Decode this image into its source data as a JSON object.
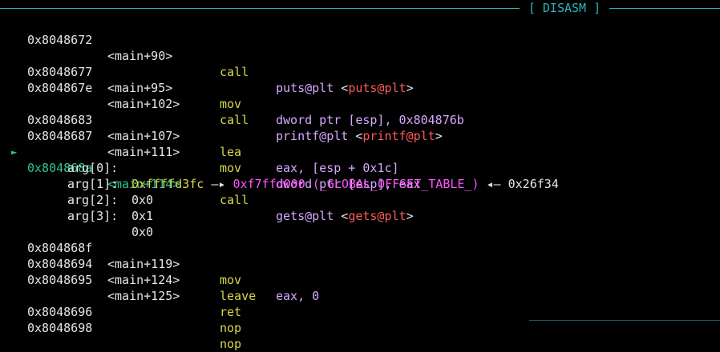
{
  "header": {
    "title": "[ DISASM ]"
  },
  "colors": {
    "accent": "#2bb3c0",
    "current": "#2fc48d",
    "mnemonic": "#d7d74f",
    "symbol": "#d6a8ff",
    "plt_target": "#ff5a5a",
    "pointer": "#ff55ff"
  },
  "lines": {
    "l0": {
      "addr": "0x8048672",
      "sym": "<main+90>",
      "mn": "call",
      "fn": "puts@plt",
      "lt": " <",
      "tgt": "puts@plt",
      "gt": ">"
    },
    "l1": {
      "addr": "0x8048677",
      "sym": "<main+95>",
      "mn": "mov",
      "op1": "dword ptr [esp], ",
      "op2": "0x804876b"
    },
    "l2": {
      "addr": "0x804867e",
      "sym": "<main+102>",
      "mn": "call",
      "fn": "printf@plt",
      "lt": " <",
      "tgt": "printf@plt",
      "gt": ">"
    },
    "l3": {
      "addr": "0x8048683",
      "sym": "<main+107>",
      "mn": "lea",
      "op1": "eax, [esp + ",
      "op2": "0x1c",
      "op3": "]"
    },
    "l4": {
      "addr": "0x8048687",
      "sym": "<main+111>",
      "mn": "mov",
      "op1": "dword ptr [esp], eax"
    },
    "l5": {
      "marker": "►",
      "addr": "0x804868a",
      "sym": "<main+114>",
      "mn": "call",
      "fn": "gets@plt",
      "lt": " <",
      "tgt": "gets@plt",
      "gt": ">"
    },
    "l6": {
      "addr": "0x804868f",
      "sym": "<main+119>",
      "mn": "mov",
      "op1": "eax, ",
      "op2": "0"
    },
    "l7": {
      "addr": "0x8048694",
      "sym": "<main+124>",
      "mn": "leave"
    },
    "l8": {
      "addr": "0x8048695",
      "sym": "<main+125>",
      "mn": "ret"
    },
    "l9": {
      "addr": "0x8048696",
      "mn": "nop"
    },
    "l10": {
      "addr": "0x8048698",
      "mn": "nop"
    }
  },
  "args": {
    "a0": {
      "name": "arg[0]: ",
      "val": "0xffffd3fc",
      "arrow": " —▸ ",
      "ptr": "0xf7ffd000 (_GLOBAL_OFFSET_TABLE_)",
      "back": " ◂— ",
      "tail": "0x26f34"
    },
    "a1": {
      "name": "arg[1]: ",
      "val": "0x0"
    },
    "a2": {
      "name": "arg[2]: ",
      "val": "0x1"
    },
    "a3": {
      "name": "arg[3]: ",
      "val": "0x0"
    }
  }
}
